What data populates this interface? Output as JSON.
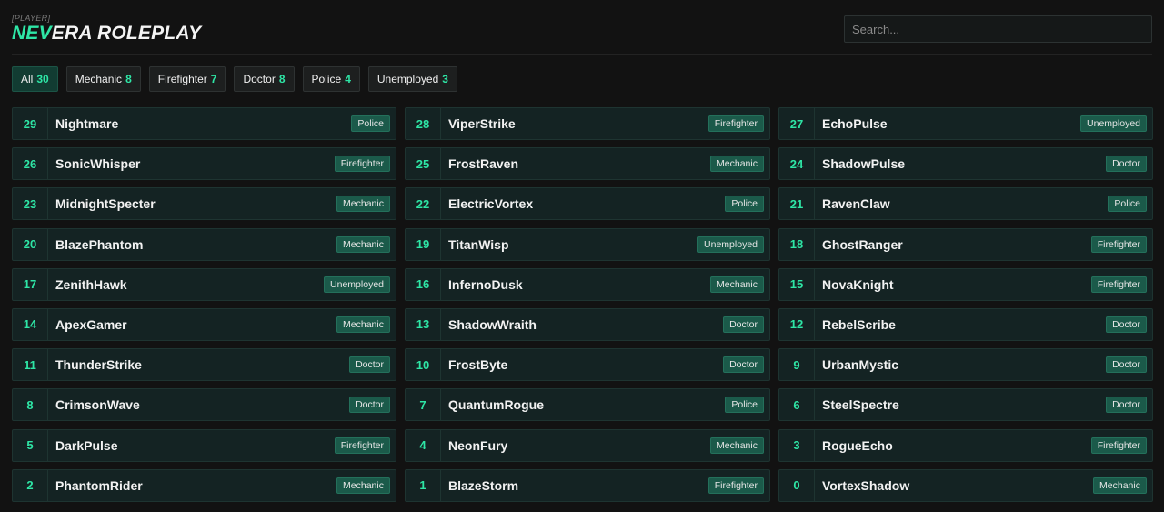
{
  "brand": {
    "tag": "[PLAYER]",
    "title_accent": "NEV",
    "title_rest": "ERA ROLEPLAY"
  },
  "search": {
    "placeholder": "Search...",
    "value": ""
  },
  "filters": [
    {
      "label": "All",
      "count": "30",
      "active": true
    },
    {
      "label": "Mechanic",
      "count": "8",
      "active": false
    },
    {
      "label": "Firefighter",
      "count": "7",
      "active": false
    },
    {
      "label": "Doctor",
      "count": "8",
      "active": false
    },
    {
      "label": "Police",
      "count": "4",
      "active": false
    },
    {
      "label": "Unemployed",
      "count": "3",
      "active": false
    }
  ],
  "players": [
    {
      "id": "29",
      "name": "Nightmare",
      "job": "Police"
    },
    {
      "id": "28",
      "name": "ViperStrike",
      "job": "Firefighter"
    },
    {
      "id": "27",
      "name": "EchoPulse",
      "job": "Unemployed"
    },
    {
      "id": "26",
      "name": "SonicWhisper",
      "job": "Firefighter"
    },
    {
      "id": "25",
      "name": "FrostRaven",
      "job": "Mechanic"
    },
    {
      "id": "24",
      "name": "ShadowPulse",
      "job": "Doctor"
    },
    {
      "id": "23",
      "name": "MidnightSpecter",
      "job": "Mechanic"
    },
    {
      "id": "22",
      "name": "ElectricVortex",
      "job": "Police"
    },
    {
      "id": "21",
      "name": "RavenClaw",
      "job": "Police"
    },
    {
      "id": "20",
      "name": "BlazePhantom",
      "job": "Mechanic"
    },
    {
      "id": "19",
      "name": "TitanWisp",
      "job": "Unemployed"
    },
    {
      "id": "18",
      "name": "GhostRanger",
      "job": "Firefighter"
    },
    {
      "id": "17",
      "name": "ZenithHawk",
      "job": "Unemployed"
    },
    {
      "id": "16",
      "name": "InfernoDusk",
      "job": "Mechanic"
    },
    {
      "id": "15",
      "name": "NovaKnight",
      "job": "Firefighter"
    },
    {
      "id": "14",
      "name": "ApexGamer",
      "job": "Mechanic"
    },
    {
      "id": "13",
      "name": "ShadowWraith",
      "job": "Doctor"
    },
    {
      "id": "12",
      "name": "RebelScribe",
      "job": "Doctor"
    },
    {
      "id": "11",
      "name": "ThunderStrike",
      "job": "Doctor"
    },
    {
      "id": "10",
      "name": "FrostByte",
      "job": "Doctor"
    },
    {
      "id": "9",
      "name": "UrbanMystic",
      "job": "Doctor"
    },
    {
      "id": "8",
      "name": "CrimsonWave",
      "job": "Doctor"
    },
    {
      "id": "7",
      "name": "QuantumRogue",
      "job": "Police"
    },
    {
      "id": "6",
      "name": "SteelSpectre",
      "job": "Doctor"
    },
    {
      "id": "5",
      "name": "DarkPulse",
      "job": "Firefighter"
    },
    {
      "id": "4",
      "name": "NeonFury",
      "job": "Mechanic"
    },
    {
      "id": "3",
      "name": "RogueEcho",
      "job": "Firefighter"
    },
    {
      "id": "2",
      "name": "PhantomRider",
      "job": "Mechanic"
    },
    {
      "id": "1",
      "name": "BlazeStorm",
      "job": "Firefighter"
    },
    {
      "id": "0",
      "name": "VortexShadow",
      "job": "Mechanic"
    }
  ],
  "colors": {
    "accent": "#2ee6a6",
    "background": "#121212",
    "card": "#142323",
    "badge": "#1b5a4a"
  }
}
